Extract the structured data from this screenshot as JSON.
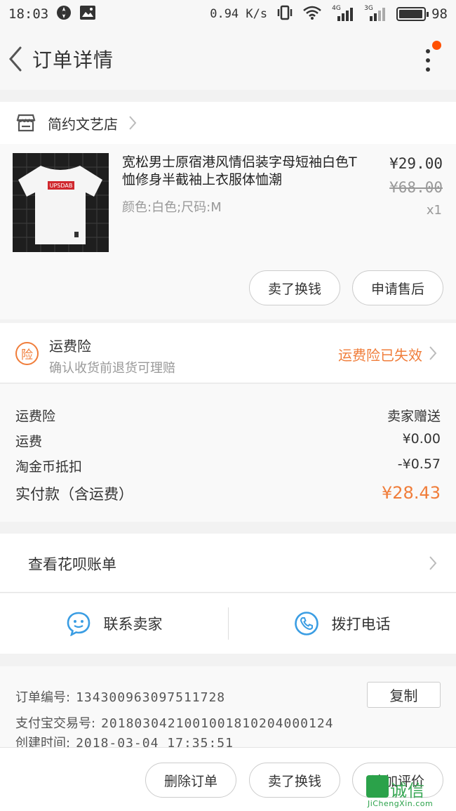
{
  "status_bar": {
    "time": "18:03",
    "speed": "0.94 K/s",
    "network_1": "4G",
    "network_2": "3G",
    "battery": "98",
    "battery_level": 0.98
  },
  "nav": {
    "title": "订单详情",
    "badge_color": "#ff5000"
  },
  "shop": {
    "name": "简约文艺店"
  },
  "item": {
    "title": "宽松男士原宿港风情侣装字母短袖白色T恤修身半截袖上衣服体恤潮",
    "sku": "颜色:白色;尺码:M",
    "price": "¥29.00",
    "original_price": "¥68.00",
    "quantity": "x1",
    "thumb_print": "UPSDAB",
    "actions": [
      "卖了换钱",
      "申请售后"
    ]
  },
  "insurance": {
    "icon_text": "险",
    "title": "运费险",
    "subtitle": "确认收货前退货可理赔",
    "status": "运费险已失效",
    "accent": "#f07d3a"
  },
  "fees": [
    {
      "label": "运费险",
      "value": "卖家赠送"
    },
    {
      "label": "运费",
      "value": "¥0.00"
    },
    {
      "label": "淘金币抵扣",
      "value": "-¥0.57"
    }
  ],
  "total": {
    "label": "实付款（含运费）",
    "value": "¥28.43"
  },
  "huabei": {
    "label": "查看花呗账单"
  },
  "contact": {
    "seller": "联系卖家",
    "phone": "拨打电话",
    "icon_color": "#3a9de3"
  },
  "order": {
    "number_label": "订单编号:",
    "number": "134300963097511728",
    "copy_label": "复制",
    "alipay_label": "支付宝交易号:",
    "alipay": "2018030421001001810204000124",
    "created_label": "创建时间:",
    "created": "2018-03-04 17:35:51"
  },
  "bottom_actions": [
    "删除订单",
    "卖了换钱",
    "追加评价"
  ],
  "watermark": {
    "text": "诚信",
    "url": "JiChengXin.com"
  }
}
